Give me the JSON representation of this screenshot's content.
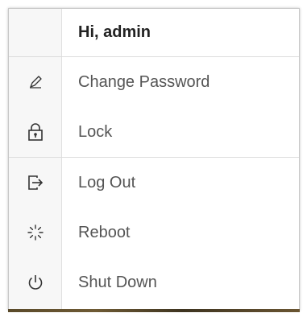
{
  "user_menu": {
    "greeting": "Hi, admin",
    "items": [
      {
        "label": "Change Password",
        "icon": "pencil-icon"
      },
      {
        "label": "Lock",
        "icon": "lock-icon"
      },
      {
        "label": "Log Out",
        "icon": "logout-icon"
      },
      {
        "label": "Reboot",
        "icon": "reboot-icon"
      },
      {
        "label": "Shut Down",
        "icon": "power-icon"
      }
    ]
  }
}
